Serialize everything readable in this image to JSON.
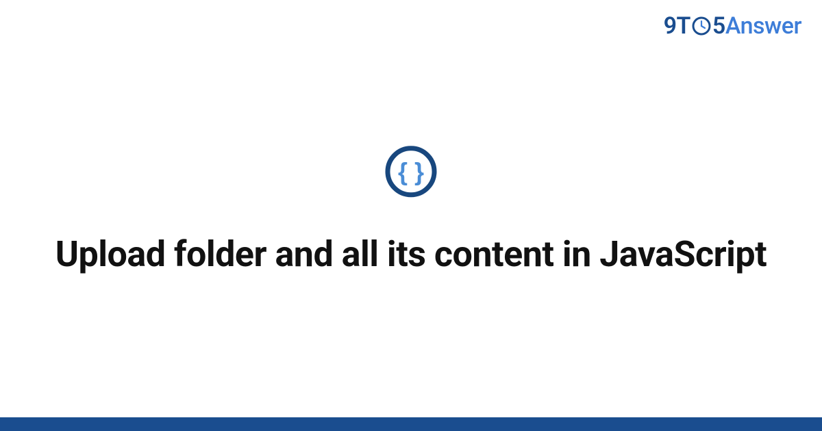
{
  "logo": {
    "part1": "9T",
    "part2": "5",
    "part3": "Answer"
  },
  "icon": {
    "name": "code-braces-icon",
    "glyph": "{ }"
  },
  "heading": "Upload folder and all its content in JavaScript",
  "colors": {
    "brand_dark": "#1a4d8f",
    "brand_light": "#3d7dd8",
    "text": "#111111"
  }
}
